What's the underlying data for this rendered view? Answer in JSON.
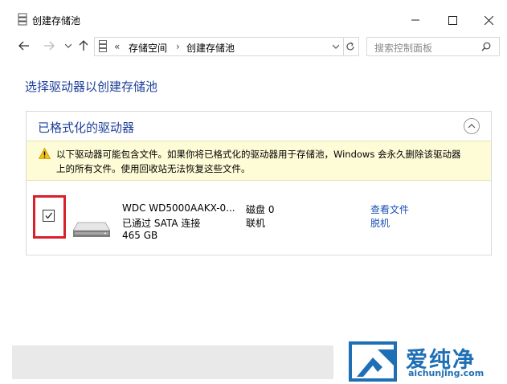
{
  "window": {
    "title": "创建存储池"
  },
  "address": {
    "overflow": "«",
    "crumbs": [
      "存储空间",
      "创建存储池"
    ],
    "search_placeholder": "搜索控制面板"
  },
  "page": {
    "heading": "选择驱动器以创建存储池"
  },
  "group": {
    "title": "已格式化的驱动器",
    "warning_line1": "以下驱动器可能包含文件。如果你将已格式化的驱动器用于存储池，Windows 会永久删除该驱动器",
    "warning_line2": "上的所有文件。使用回收站无法恢复这些文件。"
  },
  "drive": {
    "checked": true,
    "name": "WDC WD5000AAKX-0...",
    "connection": "已通过 SATA 连接",
    "size": "465 GB",
    "disk": "磁盘 0",
    "status": "联机",
    "link_view": "查看文件",
    "link_offline": "脱机"
  },
  "watermark": {
    "brand": "爱纯净",
    "url": "aichunjing.com"
  },
  "icons": {
    "title": "storage-pool-icon",
    "back": "arrow-left-icon",
    "forward": "arrow-right-icon",
    "recent": "chevron-down-icon",
    "up": "arrow-up-icon",
    "refresh": "refresh-icon",
    "search": "search-icon"
  },
  "colors": {
    "link": "#1a4fb4",
    "heading": "#1e3f9a",
    "warning_bg": "#fefcd7",
    "highlight": "#d8202a"
  }
}
